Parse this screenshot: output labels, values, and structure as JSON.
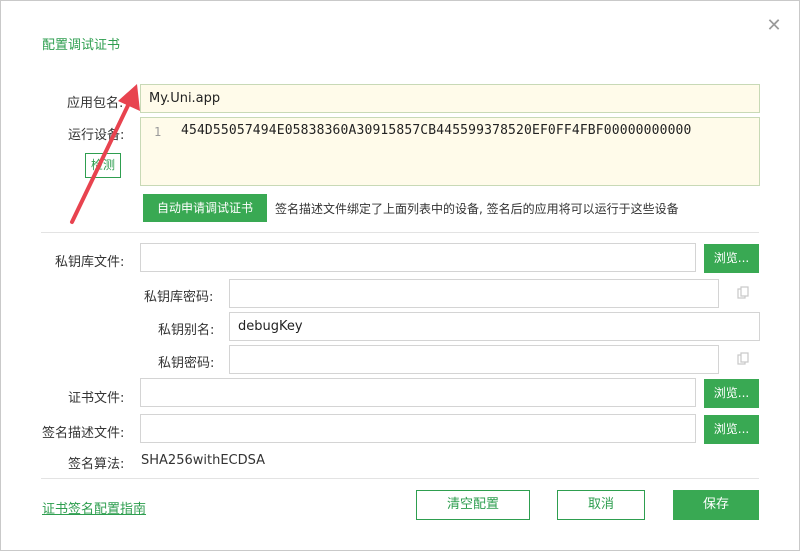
{
  "dialog": {
    "title": "配置调试证书",
    "close_glyph": "✕"
  },
  "app_package": {
    "label": "应用包名:",
    "value": "My.Uni.app"
  },
  "devices": {
    "label": "运行设备:",
    "detect_button": "检测",
    "line_number": "1",
    "code": "454D55057494E05838360A30915857CB445599378520EF0FF4FBF00000000000",
    "auto_apply_button": "自动申请调试证书",
    "hint": "签名描述文件绑定了上面列表中的设备, 签名后的应用将可以运行于这些设备"
  },
  "keystore": {
    "label": "私钥库文件:",
    "value": "",
    "browse_button": "浏览..."
  },
  "keystore_password": {
    "label": "私钥库密码:",
    "value": ""
  },
  "key_alias": {
    "label": "私钥别名:",
    "value": "debugKey"
  },
  "key_password": {
    "label": "私钥密码:",
    "value": ""
  },
  "certificate": {
    "label": "证书文件:",
    "value": "",
    "browse_button": "浏览..."
  },
  "profile": {
    "label": "签名描述文件:",
    "value": "",
    "browse_button": "浏览..."
  },
  "algorithm": {
    "label": "签名算法:",
    "value": "SHA256withECDSA"
  },
  "footer": {
    "guide_link": "证书签名配置指南",
    "clear_button": "清空配置",
    "cancel_button": "取消",
    "save_button": "保存"
  },
  "colors": {
    "accent": "#39a953",
    "annotation_arrow": "#e8434f"
  },
  "icons": {
    "copy": "copy-icon",
    "close": "close-icon"
  }
}
